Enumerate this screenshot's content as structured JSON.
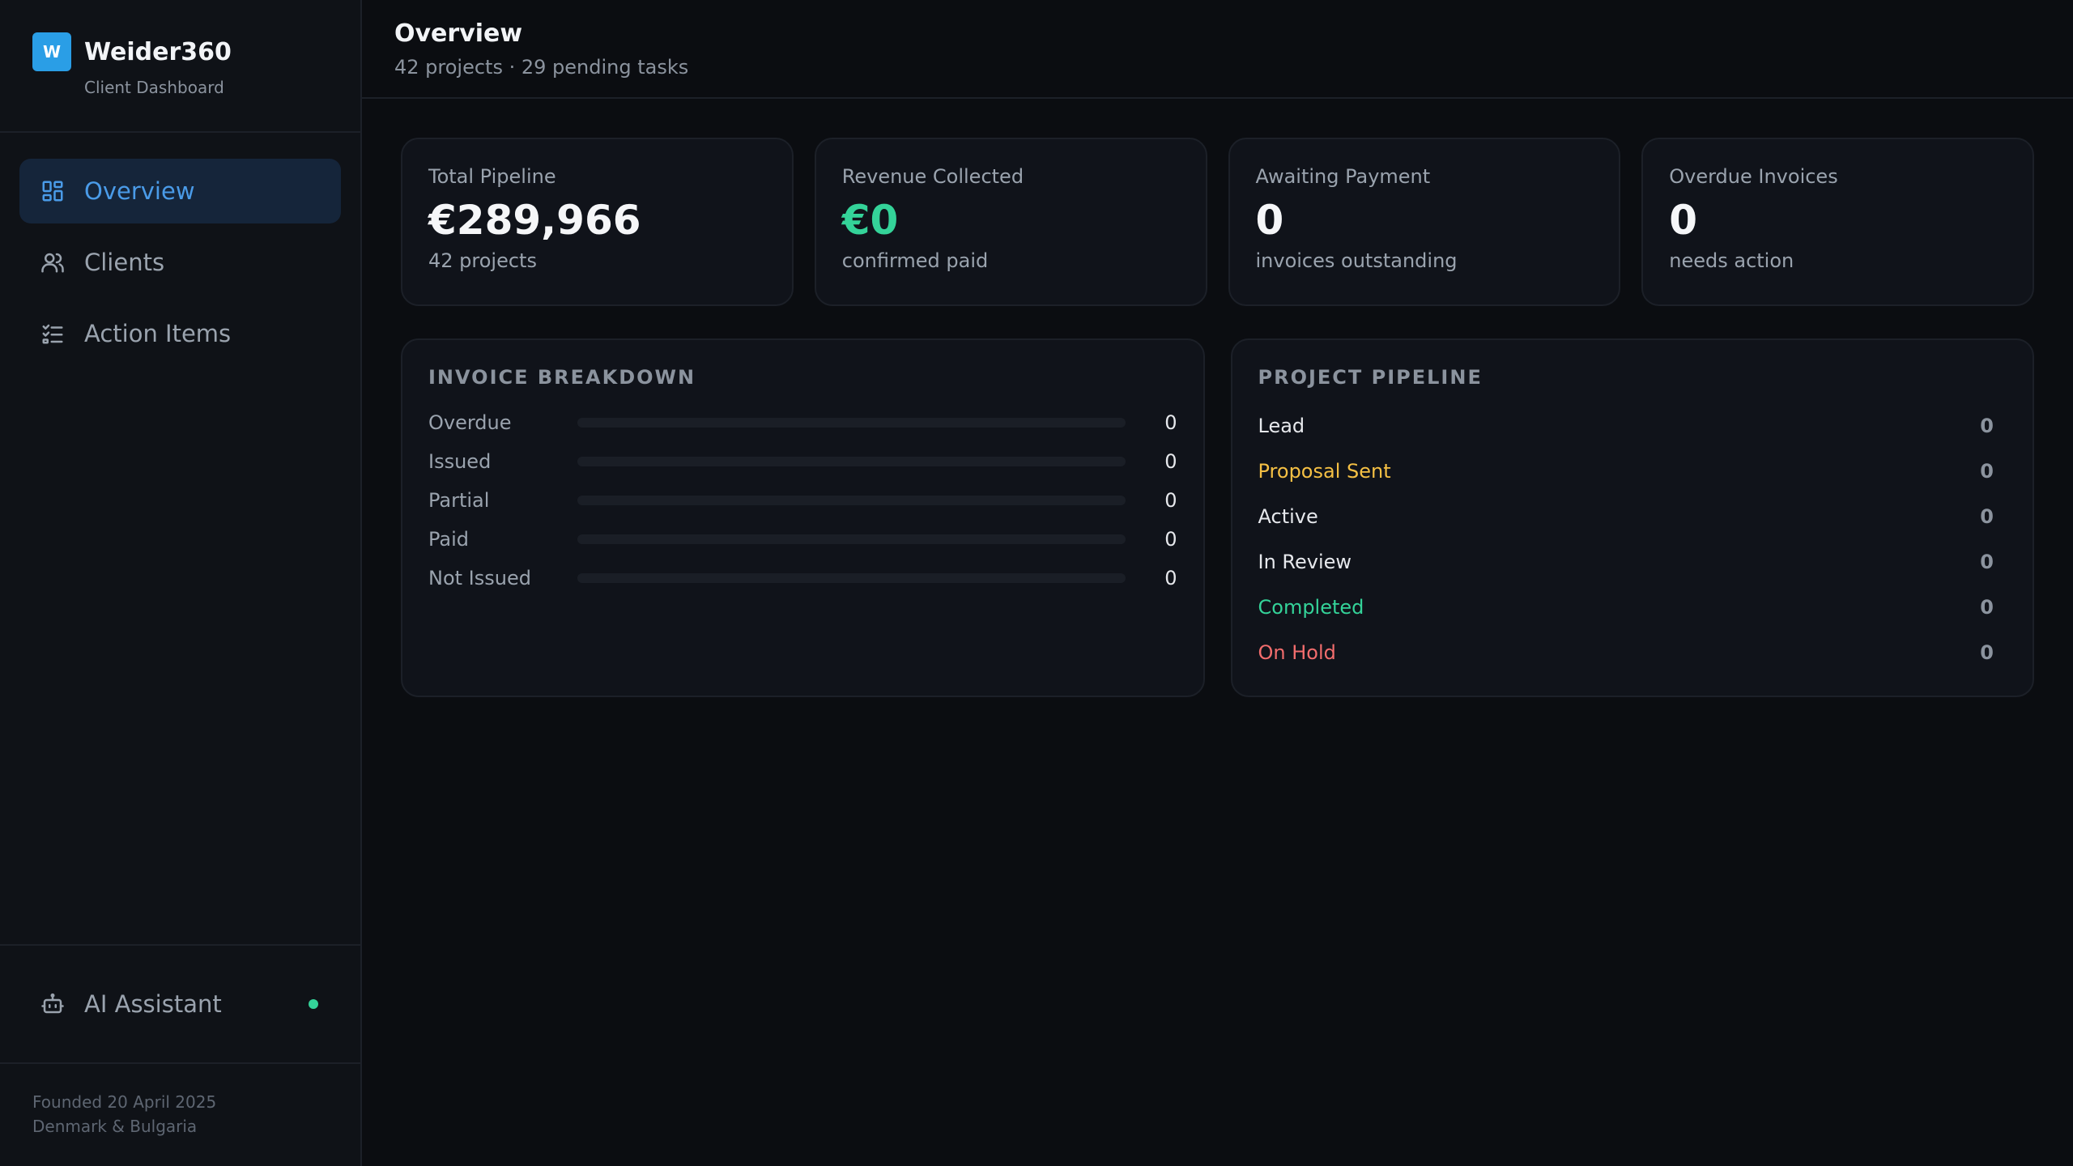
{
  "brand": {
    "logo_letter": "W",
    "name": "Weider360",
    "subtitle": "Client Dashboard",
    "logo_color": "#2a9ee6"
  },
  "nav": {
    "items": [
      {
        "label": "Overview",
        "icon": "dashboard-grid-icon",
        "active": true
      },
      {
        "label": "Clients",
        "icon": "users-icon",
        "active": false
      },
      {
        "label": "Action Items",
        "icon": "checklist-icon",
        "active": false
      }
    ]
  },
  "assistant": {
    "label": "AI Assistant",
    "icon": "robot-icon",
    "status_color": "#34d399"
  },
  "footer": {
    "line1": "Founded 20 April 2025",
    "line2": "Denmark & Bulgaria"
  },
  "header": {
    "title": "Overview",
    "subtitle": "42 projects · 29 pending tasks"
  },
  "stats": [
    {
      "label": "Total Pipeline",
      "value": "€289,966",
      "sub": "42 projects"
    },
    {
      "label": "Revenue Collected",
      "value": "€0",
      "sub": "confirmed paid",
      "accent": "#34d399"
    },
    {
      "label": "Awaiting Payment",
      "value": "0",
      "sub": "invoices outstanding"
    },
    {
      "label": "Overdue Invoices",
      "value": "0",
      "sub": "needs action"
    }
  ],
  "invoice_breakdown": {
    "title": "INVOICE BREAKDOWN",
    "rows": [
      {
        "label": "Overdue",
        "value": "0",
        "fill": 0
      },
      {
        "label": "Issued",
        "value": "0",
        "fill": 0
      },
      {
        "label": "Partial",
        "value": "0",
        "fill": 0
      },
      {
        "label": "Paid",
        "value": "0",
        "fill": 0
      },
      {
        "label": "Not Issued",
        "value": "0",
        "fill": 0
      }
    ]
  },
  "project_pipeline": {
    "title": "PROJECT PIPELINE",
    "rows": [
      {
        "label": "Lead",
        "value": "0",
        "color": "#e6e8ec"
      },
      {
        "label": "Proposal Sent",
        "value": "0",
        "color": "#f5c044"
      },
      {
        "label": "Active",
        "value": "0",
        "color": "#e6e8ec"
      },
      {
        "label": "In Review",
        "value": "0",
        "color": "#e6e8ec"
      },
      {
        "label": "Completed",
        "value": "0",
        "color": "#34d399"
      },
      {
        "label": "On Hold",
        "value": "0",
        "color": "#f26d6d"
      }
    ]
  }
}
